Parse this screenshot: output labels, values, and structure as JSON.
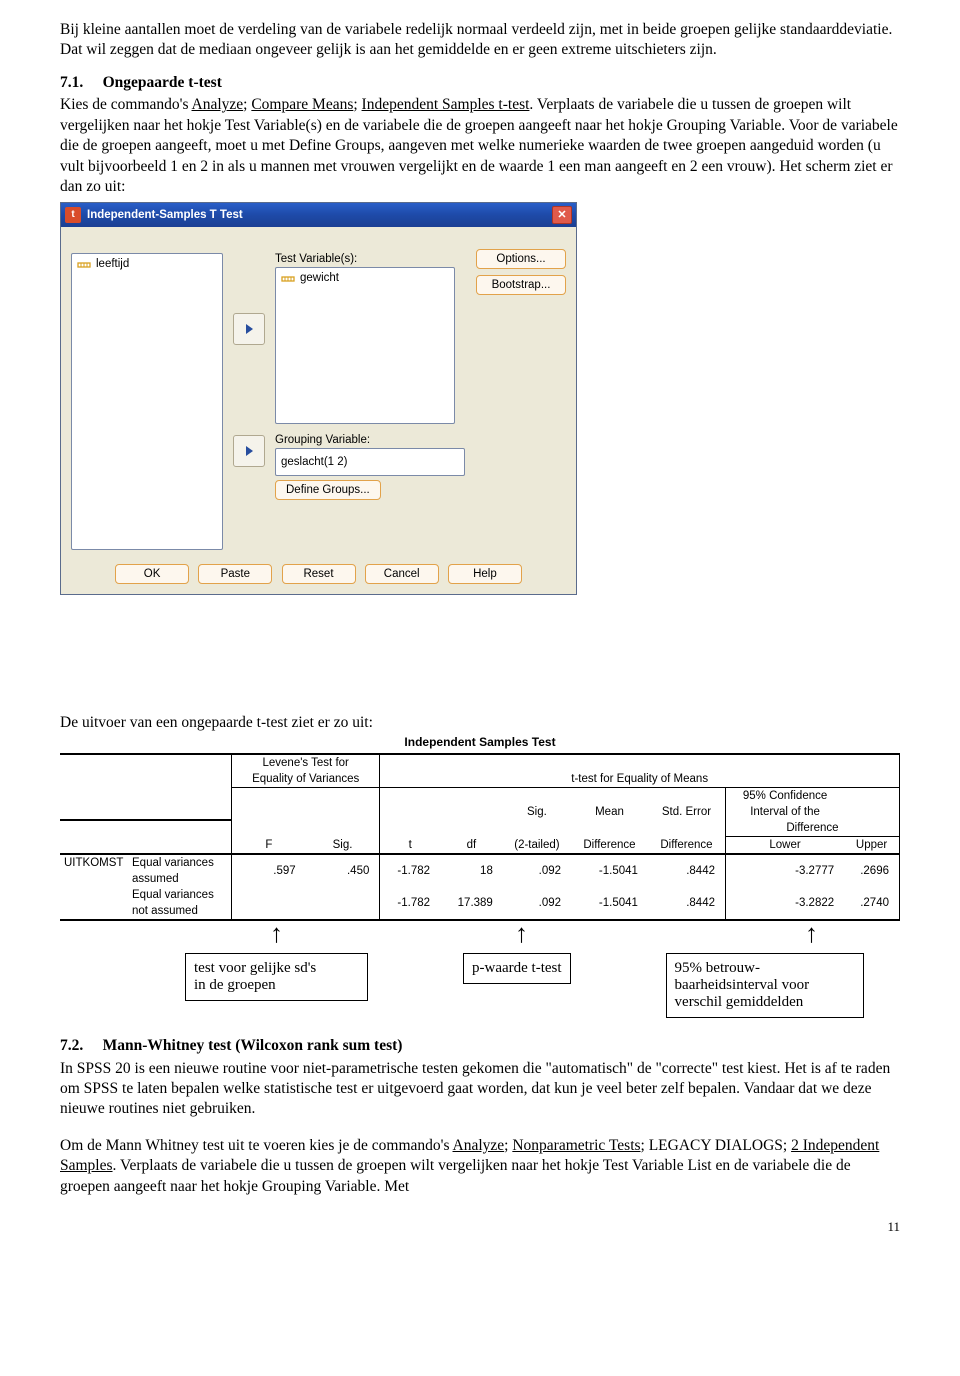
{
  "para1": "Bij kleine aantallen moet de verdeling van de variabele redelijk normaal verdeeld zijn, met in beide groepen gelijke standaarddeviatie. Dat wil zeggen dat de mediaan ongeveer gelijk is aan het gemiddelde en er geen extreme uitschieters zijn.",
  "sec71_num": "7.1.",
  "sec71_title": "Ongepaarde t-test",
  "para2a": "Kies de commando's ",
  "para2_u1": "Analyze",
  "para2b": "; ",
  "para2_u2": "Compare Means",
  "para2c": "; ",
  "para2_u3": "Independent Samples t-test",
  "para2d": ". Verplaats de variabele die u tussen de groepen wilt vergelijken naar het hokje Test Variable(s) en de variabele die de groepen aangeeft naar het hokje Grouping Variable. Voor de variabele die de groepen aangeeft, moet u met Define Groups, aangeven met welke numerieke waarden de twee groepen aangeduid worden (u vult bijvoorbeeld 1 en 2 in als u mannen met vrouwen vergelijkt en de waarde 1 een man aangeeft en 2 een vrouw). Het scherm ziet er dan zo uit:",
  "dialog": {
    "title": "Independent-Samples T Test",
    "left_var": "leeftijd",
    "test_var_label": "Test Variable(s):",
    "test_var_value": "gewicht",
    "group_var_label": "Grouping Variable:",
    "group_var_value": "geslacht(1 2)",
    "define_groups": "Define Groups...",
    "options": "Options...",
    "bootstrap": "Bootstrap...",
    "ok": "OK",
    "paste": "Paste",
    "reset": "Reset",
    "cancel": "Cancel",
    "help": "Help"
  },
  "para3": "De uitvoer van een ongepaarde t-test ziet er zo uit:",
  "chart_data": {
    "type": "table",
    "title": "Independent Samples Test",
    "column_groups": [
      {
        "name": "Levene's Test for Equality of Variances",
        "columns": [
          "F",
          "Sig."
        ]
      },
      {
        "name": "t-test for Equality of Means",
        "columns": [
          "t",
          "df",
          "Sig. (2-tailed)",
          "Mean Difference",
          "Std. Error Difference",
          "95% Confidence Interval of the Difference Lower",
          "95% Confidence Interval of the Difference Upper"
        ]
      }
    ],
    "rows": [
      {
        "var": "UITKOMST",
        "label": "Equal variances assumed",
        "F": 0.597,
        "Sig": 0.45,
        "t": -1.782,
        "df": 18,
        "Sig2": 0.092,
        "MeanDiff": -1.5041,
        "SEDiff": 0.8442,
        "Lower": -3.2777,
        "Upper": 0.2696
      },
      {
        "var": "",
        "label": "Equal variances not assumed",
        "F": null,
        "Sig": null,
        "t": -1.782,
        "df": 17.389,
        "Sig2": 0.092,
        "MeanDiff": -1.5041,
        "SEDiff": 0.8442,
        "Lower": -3.2822,
        "Upper": 0.274
      }
    ]
  },
  "table_hdrs": {
    "levene1": "Levene's Test for",
    "levene2": "Equality of Variances",
    "ttest": "t-test for Equality of Means",
    "ci1": "95% Confidence",
    "ci2": "Interval of the",
    "ci3": "Difference",
    "F": "F",
    "Sig": "Sig.",
    "t": "t",
    "df": "df",
    "sig2a": "Sig.",
    "sig2b": "(2-tailed)",
    "mean1": "Mean",
    "mean2": "Difference",
    "se1": "Std. Error",
    "se2": "Difference",
    "lower": "Lower",
    "upper": "Upper"
  },
  "table_rows": {
    "varname": "UITKOMST",
    "r1_label1": "Equal variances",
    "r1_label2": "assumed",
    "r1": {
      "F": ".597",
      "Sig": ".450",
      "t": "-1.782",
      "df": "18",
      "Sig2": ".092",
      "MeanDiff": "-1.5041",
      "SEDiff": ".8442",
      "Lower": "-3.2777",
      "Upper": ".2696"
    },
    "r2_label1": "Equal variances",
    "r2_label2": "not assumed",
    "r2": {
      "t": "-1.782",
      "df": "17.389",
      "Sig2": ".092",
      "MeanDiff": "-1.5041",
      "SEDiff": ".8442",
      "Lower": "-3.2822",
      "Upper": ".2740"
    }
  },
  "annot1a": "test voor gelijke sd's",
  "annot1b": "in de groepen",
  "annot2": "p-waarde t-test",
  "annot3a": "95% betrouw-",
  "annot3b": "baarheidsinterval voor",
  "annot3c": "verschil gemiddelden",
  "sec72_num": "7.2.",
  "sec72_title": "Mann-Whitney test (Wilcoxon rank sum test)",
  "para4": "In SPSS 20 is een nieuwe routine voor niet-parametrische testen gekomen die \"automatisch\" de \"correcte\" test kiest. Het is af te raden om SPSS te laten bepalen welke statistische test er uitgevoerd gaat worden, dat kun je veel beter zelf bepalen. Vandaar dat we deze nieuwe routines niet gebruiken.",
  "para5a": "Om de Mann Whitney test uit te voeren kies je de commando's ",
  "para5_u1": "Analyze",
  "para5b": "; ",
  "para5_u2": "Nonparametric Tests",
  "para5c": "; LEGACY DIALOGS; ",
  "para5_u3": "2 Independent Samples",
  "para5d": ". Verplaats de variabele die u tussen de groepen wilt vergelijken naar het hokje Test Variable List en de variabele die de groepen aangeeft naar het hokje Grouping Variable. Met",
  "pagenum": "11"
}
